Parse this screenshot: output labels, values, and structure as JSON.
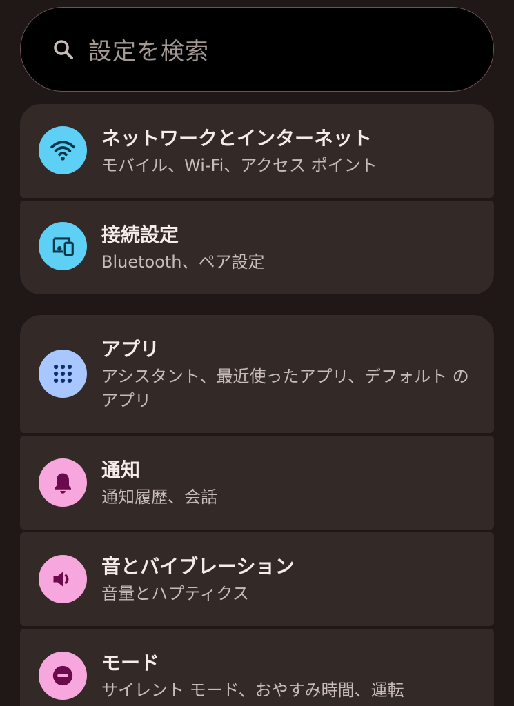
{
  "search": {
    "placeholder": "設定を検索"
  },
  "items": [
    {
      "title": "ネットワークとインターネット",
      "subtitle": "モバイル、Wi-Fi、アクセス ポイント",
      "icon": "wifi-icon",
      "color": "#5ed0f5"
    },
    {
      "title": "接続設定",
      "subtitle": "Bluetooth、ペア設定",
      "icon": "connected-devices-icon",
      "color": "#5ed0f5"
    },
    {
      "title": "アプリ",
      "subtitle": "アシスタント、最近使ったアプリ、デフォルト のアプリ",
      "icon": "apps-grid-icon",
      "color": "#a8c6ff"
    },
    {
      "title": "通知",
      "subtitle": "通知履歴、会話",
      "icon": "bell-icon",
      "color": "#f7a7dd"
    },
    {
      "title": "音とバイブレーション",
      "subtitle": "音量とハプティクス",
      "icon": "speaker-icon",
      "color": "#f7a7dd"
    },
    {
      "title": "モード",
      "subtitle": "サイレント モード、おやすみ時間、運転",
      "icon": "do-not-disturb-icon",
      "color": "#f7a7dd"
    }
  ]
}
